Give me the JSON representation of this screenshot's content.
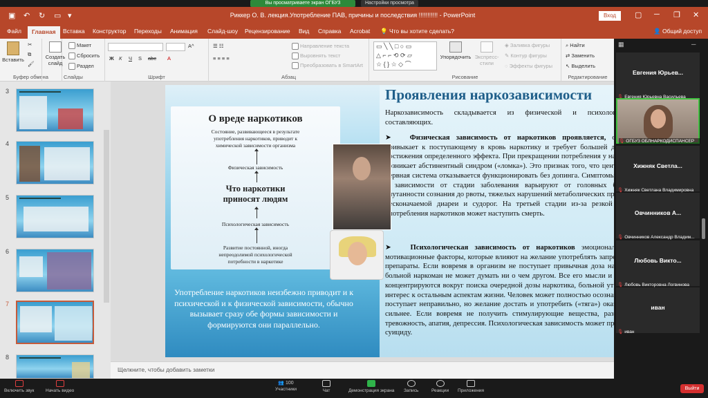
{
  "share_banner": {
    "text": "Вы просматриваете экран ОГБУЗ ОБЛНАРКОДИСПАНСЕР",
    "options": "Настройки просмотра"
  },
  "titlebar": {
    "title": "Риккер О. В. лекция.Употребление ПАВ, причины и последствия  !!!!!!!!!!! - PowerPoint",
    "login": "Вход"
  },
  "tabs": [
    "Файл",
    "Главная",
    "Вставка",
    "Конструктор",
    "Переходы",
    "Анимация",
    "Слайд-шоу",
    "Рецензирование",
    "Вид",
    "Справка",
    "Acrobat",
    "Что вы хотите сделать?",
    "Общий доступ"
  ],
  "ribbon": {
    "clipboard": {
      "paste": "Вставить",
      "group": "Буфер обмена"
    },
    "slides": {
      "create": "Создать слайд",
      "layout": "Макет",
      "reset": "Сбросить",
      "section": "Раздел",
      "group": "Слайды"
    },
    "font": {
      "group": "Шрифт",
      "size": "",
      "name": ""
    },
    "paragraph": {
      "dir": "Направление текста",
      "align": "Выровнять текст",
      "smartart": "Преобразовать в SmartArt",
      "group": "Абзац"
    },
    "drawing": {
      "arrange": "Упорядочить",
      "quick": "Экспресс-стили",
      "fill": "Заливка фигуры",
      "outline": "Контур фигуры",
      "effects": "Эффекты фигуры",
      "group": "Рисование"
    },
    "editing": {
      "find": "Найти",
      "replace": "Заменить",
      "select": "Выделить",
      "group": "Редактирование"
    }
  },
  "thumbnails": [
    {
      "num": "3"
    },
    {
      "num": "4"
    },
    {
      "num": "5"
    },
    {
      "num": "6"
    },
    {
      "num": "7"
    },
    {
      "num": "8"
    }
  ],
  "slide": {
    "heading": "Проявления наркозависимости",
    "intro": "Наркозависимость складывается из физической и психологической составляющих.",
    "physical_title": "Физическая зависимость от наркотиков проявляется,",
    "physical_body": "организм привыкает к поступающему в кровь наркотику и требует большей дозы для достижения определенного эффекта. При прекращении потребления у наркомана возникает абстинентный синдром («ломка»). Это признак того, что центральная нервная система отказывается функционировать без допинга. Симптомы отмены в зависимости от стадии заболевания варьируют от головных болей и спутанности сознания до рвоты, тяжелых нарушений метаболических процессов, несконачаемой диареи и судорог. На третьей стадии из-за резкой отмены употребления наркотиков может наступить смерть.",
    "psych_title": "Психологическая зависимость от наркотиков",
    "psych_body": "эмоциональные и мотивационные факторы, которые влияют на желание употреблять запрещенные препараты. Если вовремя в организм не поступает привычная доза наркотика, больной наркоман не может думать ни о чем другом. Все его мысли и желания концентрируются вокруг поиска очередной дозы наркотика, больной утрачивает интерес к остальным аспектам жизни. Человек может полностью осознавать, что поступает неправильно, но желание достать и употребить («тяга») оказывается сильнее. Если вовремя не получить стимулирующие вещества, развивается тревожность, апатия, депрессия. Психологическая зависимость может привести к суициду.",
    "card": {
      "title": "О вреде наркотиков",
      "state": "Состояние, развивающееся в результате употребления наркотиков, приводит к химической зависимости организма",
      "physical": "Физическая зависимость",
      "center": "Что наркотики приносят людям",
      "psych": "Психологическая зависимость",
      "need": "Развитие постоянной, иногда непреодолимой психологической потребности в наркотике"
    },
    "quote": "Употребление наркотиков неизбежно приводит и к психической и к физической зависимости, обычно вызывает сразу обе формы зависимости и формируются они параллельно."
  },
  "notes": "Щелкните, чтобы добавить заметки",
  "participants": [
    {
      "name": "Евгения  Юрьев...",
      "label": "Евгения Юрьевна Васильева",
      "video": false
    },
    {
      "name": "",
      "label": "ОГБУЗ ОБЛНАРКОДИСПАНСЕР",
      "video": true
    },
    {
      "name": "Хижняк  Светла...",
      "label": "Хижняк Светлана Владимировна",
      "video": false
    },
    {
      "name": "Овчинников  А...",
      "label": "Овчинников Александр Владим...",
      "video": false
    },
    {
      "name": "Любовь  Викто...",
      "label": "Любовь Викторовна Логвинова",
      "video": false
    },
    {
      "name": "иван",
      "label": "иван",
      "video": false
    }
  ],
  "zoombar": {
    "mute": "Включить звук",
    "video": "Начать видео",
    "participants": "Участники",
    "participants_count": "100",
    "chat": "Чат",
    "share": "Демонстрация экрана",
    "record": "Запись",
    "reactions": "Реакции",
    "apps": "Приложения",
    "leave": "Выйти"
  },
  "colors": {
    "accent": "#b7472a",
    "zoom_green": "#2fb34a",
    "leave_red": "#d42f2f"
  }
}
